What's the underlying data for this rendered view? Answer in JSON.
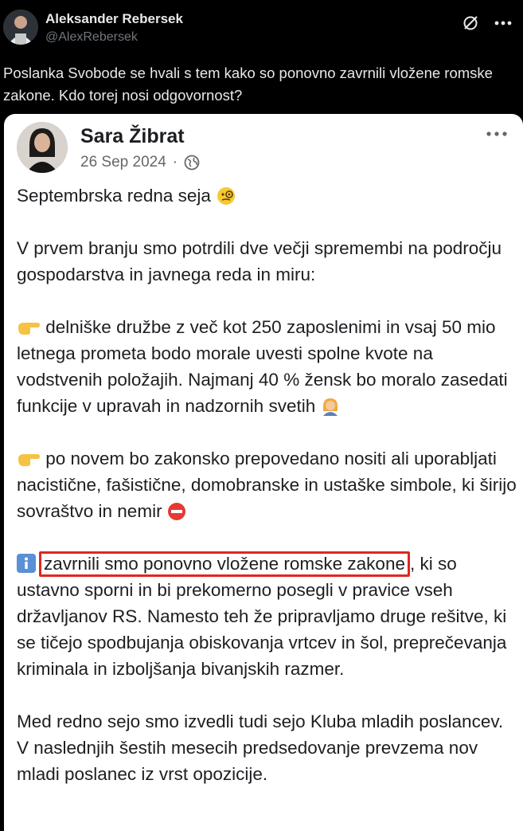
{
  "tweet": {
    "author_name": "Aleksander Rebersek",
    "author_handle": "@AlexRebersek",
    "text": "Poslanka Svobode se hvali s tem kako so ponovno zavrnili vložene romske zakone. Kdo torej nosi odgovornost?"
  },
  "post": {
    "author_name": "Sara Žibrat",
    "date": "26 Sep 2024",
    "separator": "·",
    "title": "Septembrska redna seja",
    "intro": "V prvem branju smo potrdili dve večji spremembi na področju gospodarstva in javnega reda in miru:",
    "item1": "delniške družbe z več kot 250 zaposlenimi in vsaj 50 mio letnega prometa bodo morale uvesti spolne kvote na vodstvenih položajih. Najmanj 40 % žensk bo moralo zasedati funkcije v upravah in nadzornih svetih",
    "item2": "po novem bo zakonsko prepovedano nositi ali uporabljati nacistične, fašistične, domobranske in ustaške simbole, ki širijo sovraštvo in nemir",
    "item3_highlight": "zavrnili smo ponovno vložene romske zakone",
    "item3_rest": ", ki so ustavno sporni in bi prekomerno posegli v pravice vseh državljanov RS. Namesto teh že pripravljamo druge rešitve, ki se tičejo spodbujanja obiskovanja vrtcev in šol, preprečevanja kriminala in izboljšanja bivanjskih razmer.",
    "closing": "Med redno sejo smo izvedli tudi sejo Kluba mladih poslancev. V naslednjih šestih mesecih predsedovanje prevzema nov mladi poslanec iz vrst opozicije."
  },
  "colors": {
    "background": "#000000",
    "card": "#ffffff",
    "highlight_border": "#e0261e",
    "muted": "#71767b"
  },
  "icons": [
    "grok-icon",
    "more-horizontal-icon",
    "globe-icon",
    "monocle-face-emoji",
    "pointing-hand-emoji",
    "woman-office-worker-emoji",
    "no-entry-emoji",
    "information-emoji"
  ]
}
